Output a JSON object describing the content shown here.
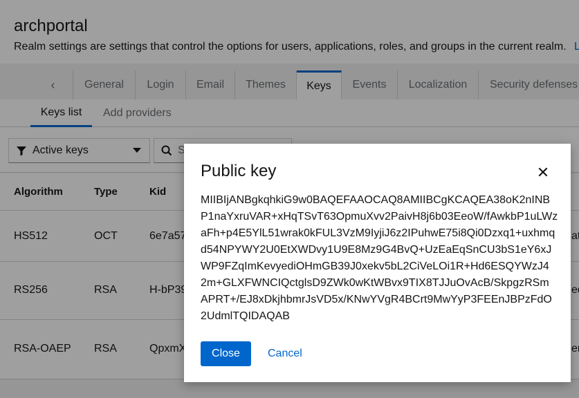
{
  "header": {
    "title": "archportal",
    "description": "Realm settings are settings that control the options for users, applications, roles, and groups in the current realm.",
    "link_fragment": "L"
  },
  "tabs": {
    "scroll_left_icon": "chevron-left-icon",
    "items": [
      {
        "label": "General"
      },
      {
        "label": "Login"
      },
      {
        "label": "Email"
      },
      {
        "label": "Themes"
      },
      {
        "label": "Keys"
      },
      {
        "label": "Events"
      },
      {
        "label": "Localization"
      },
      {
        "label": "Security defenses"
      }
    ],
    "active": "Keys"
  },
  "subtabs": {
    "items": [
      {
        "label": "Keys list"
      },
      {
        "label": "Add providers"
      }
    ],
    "active": "Keys list"
  },
  "toolbar": {
    "filter_label": "Active keys",
    "search_placeholder_fragment": "S"
  },
  "table": {
    "columns": [
      "Algorithm",
      "Type",
      "Kid"
    ],
    "rows": [
      {
        "algorithm": "HS512",
        "type": "OCT",
        "kid": "6e7a57",
        "extra": "at"
      },
      {
        "algorithm": "RS256",
        "type": "RSA",
        "kid": "H-bP39",
        "extra": "ed"
      },
      {
        "algorithm": "RSA-OAEP",
        "type": "RSA",
        "kid": "QpxmX",
        "extra": "er"
      }
    ]
  },
  "modal": {
    "title": "Public key",
    "close_icon": "close-icon",
    "key_lines": [
      "MIIBIjANBgkqhkiG9w0BAQEFAAOCAQ8AMIIBCgKCAQEA38oK2nINB",
      "P1naYxruVAR+xHqTSvT63OpmuXvv2PaivH8j6b03EeoW/fAwkbP1uLWz",
      "aFh+p4E5YlL51wrak0kFUL3VzM9IyjiJ6z2IPuhwE75i8Qi0Dzxq1+uxhmq",
      "d54NPYWY2U0EtXWDvy1U9E8Mz9G4BvQ+UzEaEqSnCU3bS1eY6xJ",
      "WP9FZqImKevyediOHmGB39J0xekv5bL2CiVeLOi1R+Hd6ESQYWzJ4",
      "2m+GLXFWNCIQctglsD9ZWk0wKtWBvx9TIX8TJJuOvAcB/SkpgzRSm",
      "APRT+/EJ8xDkjhbmrJsVD5x/KNwYVgR4BCrt9MwYyP3FEEnJBPzFdO",
      "2UdmlTQIDAQAB"
    ],
    "primary_button": "Close",
    "secondary_button": "Cancel"
  }
}
